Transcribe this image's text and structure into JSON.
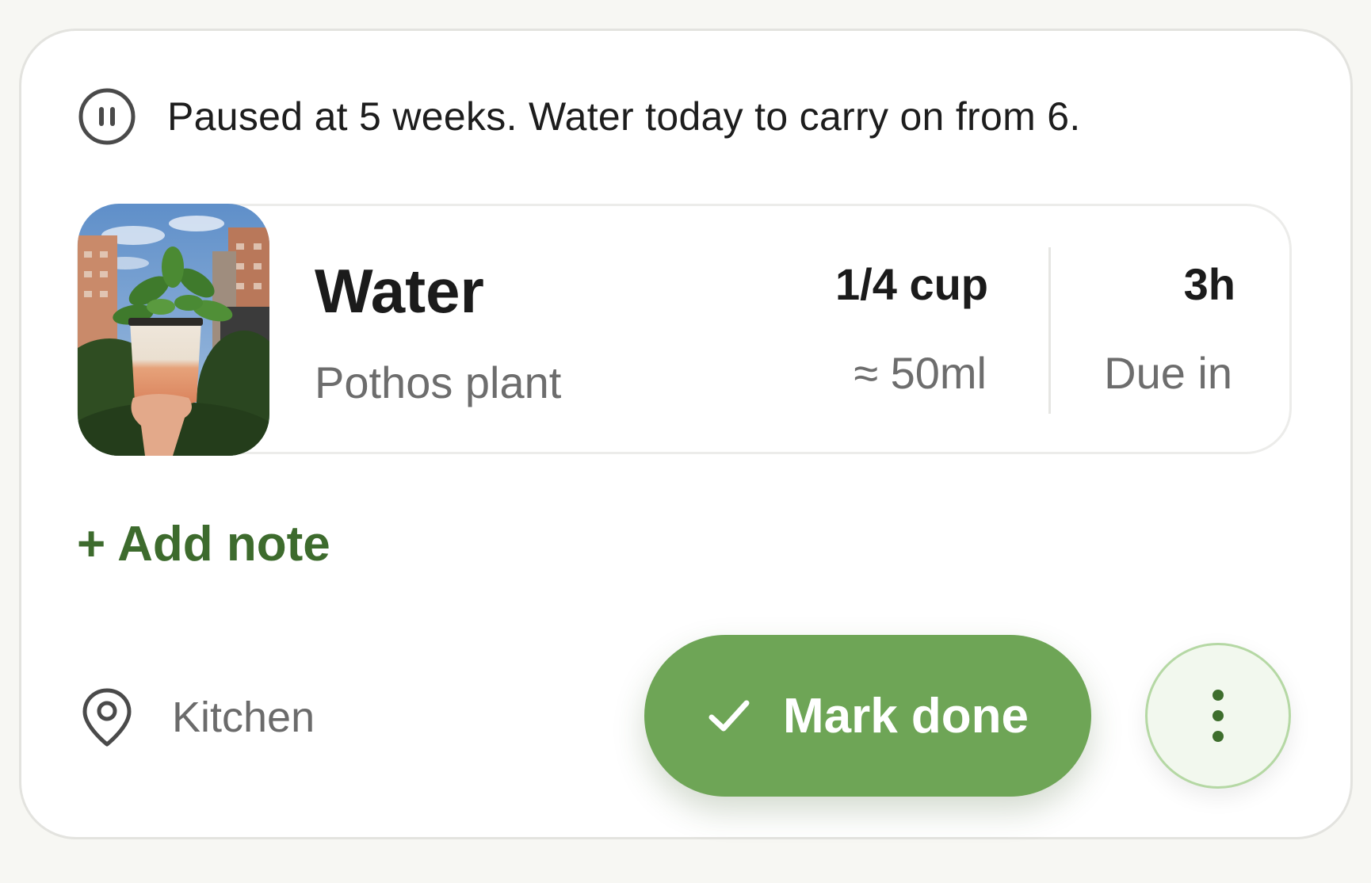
{
  "banner": {
    "icon": "pause-circle-icon",
    "text": "Paused at 5 weeks. Water today to carry on from 6."
  },
  "task": {
    "title": "Water",
    "plant": "Pothos plant",
    "amount": "1/4 cup",
    "amount_ml": "≈ 50ml",
    "due_value": "3h",
    "due_label": "Due in"
  },
  "add_note_label": "+ Add note",
  "location": {
    "icon": "map-pin-icon",
    "label": "Kitchen"
  },
  "actions": {
    "mark_done_label": "Mark done",
    "mark_done_icon": "check-icon",
    "more_icon": "more-vertical-icon"
  },
  "colors": {
    "accent": "#6ea556",
    "accent_text": "#3d6b2d",
    "more_border": "#b5d8a4"
  }
}
